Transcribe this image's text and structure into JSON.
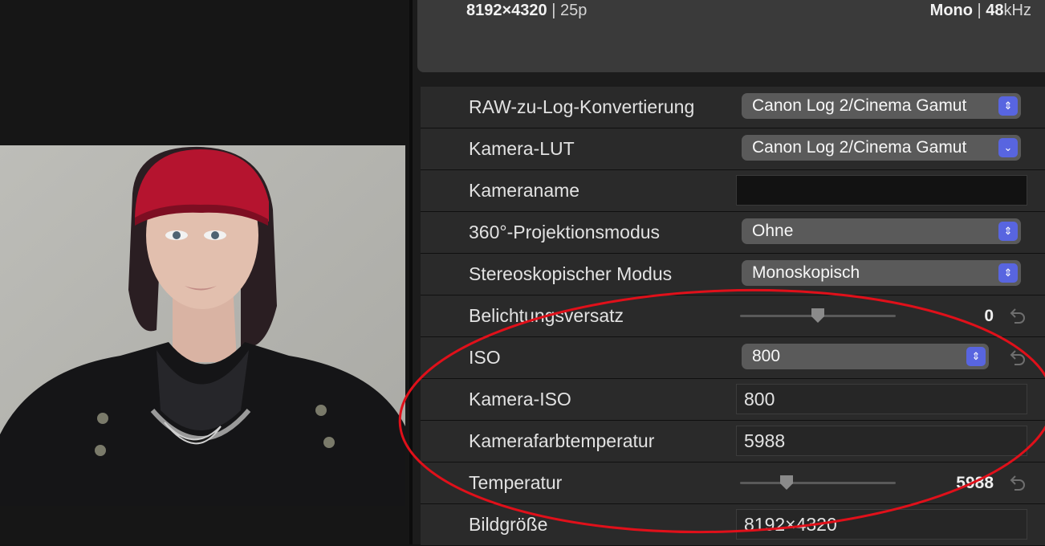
{
  "header": {
    "resolution": "8192×4320",
    "frame_rate": "25p",
    "audio_channels": "Mono",
    "sample_rate": "48",
    "sample_rate_unit": "kHz"
  },
  "properties": [
    {
      "name": "raw-to-log",
      "label": "RAW-zu-Log-Konvertierung",
      "type": "popup",
      "value": "Canon Log 2/Cinema Gamut",
      "icon": "chevron-updown-icon"
    },
    {
      "name": "camera-lut",
      "label": "Kamera-LUT",
      "type": "popup",
      "value": "Canon Log 2/Cinema Gamut",
      "icon": "chevron-down-icon"
    },
    {
      "name": "camera-name",
      "label": "Kameraname",
      "type": "field",
      "value": ""
    },
    {
      "name": "projection-mode",
      "label": "360°-Projektionsmodus",
      "type": "popup",
      "value": "Ohne",
      "icon": "chevron-updown-icon"
    },
    {
      "name": "stereoscopic-mode",
      "label": "Stereoskopischer Modus",
      "type": "popup",
      "value": "Monoskopisch",
      "icon": "chevron-updown-icon"
    },
    {
      "name": "exposure-offset",
      "label": "Belichtungsversatz",
      "type": "slider",
      "value": "0",
      "slider_fraction": 0.5
    },
    {
      "name": "iso",
      "label": "ISO",
      "type": "popup-reset",
      "value": "800",
      "icon": "chevron-updown-icon"
    },
    {
      "name": "camera-iso",
      "label": "Kamera-ISO",
      "type": "field",
      "value": "800"
    },
    {
      "name": "camera-color-temp",
      "label": "Kamerafarbtemperatur",
      "type": "field",
      "value": "5988"
    },
    {
      "name": "temperature",
      "label": "Temperatur",
      "type": "slider",
      "value": "5988",
      "slider_fraction": 0.3
    },
    {
      "name": "image-size",
      "label": "Bildgröße",
      "type": "field",
      "value": "8192×4320"
    }
  ],
  "colors": {
    "accent": "#5865e0",
    "annotation": "#e0101a"
  }
}
